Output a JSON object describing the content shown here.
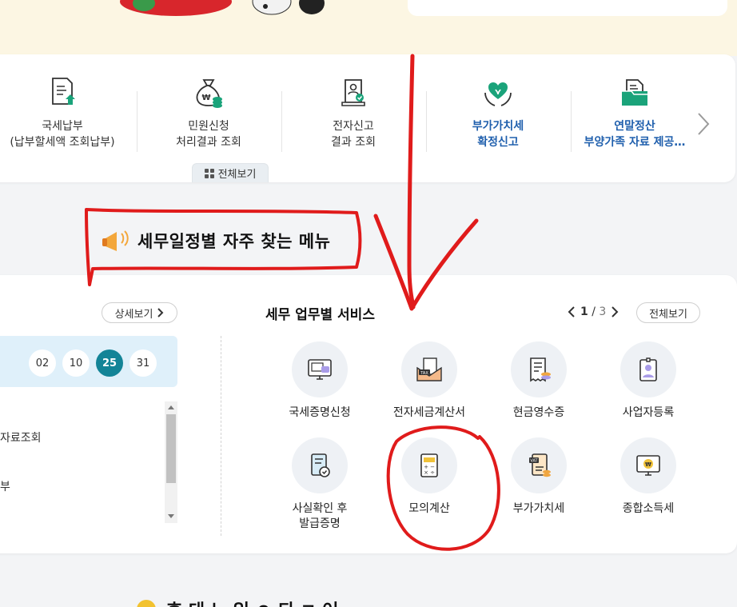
{
  "quick_menu": {
    "items": [
      {
        "label": "국세납부\n(납부할세액 조회납부)",
        "icon": "tax-payment-icon"
      },
      {
        "label": "민원신청\n처리결과 조회",
        "icon": "money-bag-icon"
      },
      {
        "label": "전자신고\n결과 조회",
        "icon": "electronic-filing-icon"
      },
      {
        "label": "부가가치세\n확정신고",
        "icon": "vat-heart-icon"
      },
      {
        "label": "연말정산\n부양가족 자료 제공…",
        "icon": "year-end-folder-icon"
      }
    ],
    "view_all": "전체보기"
  },
  "section_title": "세무일정별 자주 찾는 메뉴",
  "schedule": {
    "detail_button": "상세보기",
    "dates": [
      "02",
      "10",
      "25",
      "31"
    ],
    "active_date": "25",
    "list_items": [
      "자료조회",
      "부"
    ]
  },
  "services": {
    "title": "세무 업무별 서비스",
    "page_current": "1",
    "page_separator": "/",
    "page_total": "3",
    "view_all": "전체보기",
    "items": [
      {
        "label": "국세증명신청",
        "icon": "certificate-monitor-icon"
      },
      {
        "label": "전자세금계산서",
        "icon": "tax-invoice-envelope-icon"
      },
      {
        "label": "현금영수증",
        "icon": "cash-receipt-icon"
      },
      {
        "label": "사업자등록",
        "icon": "business-registration-icon"
      },
      {
        "label": "사실확인 후\n발급증명",
        "icon": "fact-confirmation-icon"
      },
      {
        "label": "모의계산",
        "icon": "calculator-icon"
      },
      {
        "label": "부가가치세",
        "icon": "vat-document-icon"
      },
      {
        "label": "종합소득세",
        "icon": "income-tax-monitor-icon"
      }
    ]
  },
  "bottom_section_title": "후 대 느 있 ㅇ 되 ㅋ 어",
  "colors": {
    "annotation_red": "#e01b1b",
    "active_date": "#138497",
    "blue_link": "#1f5fad",
    "banner_bg": "#fcf6e3"
  }
}
